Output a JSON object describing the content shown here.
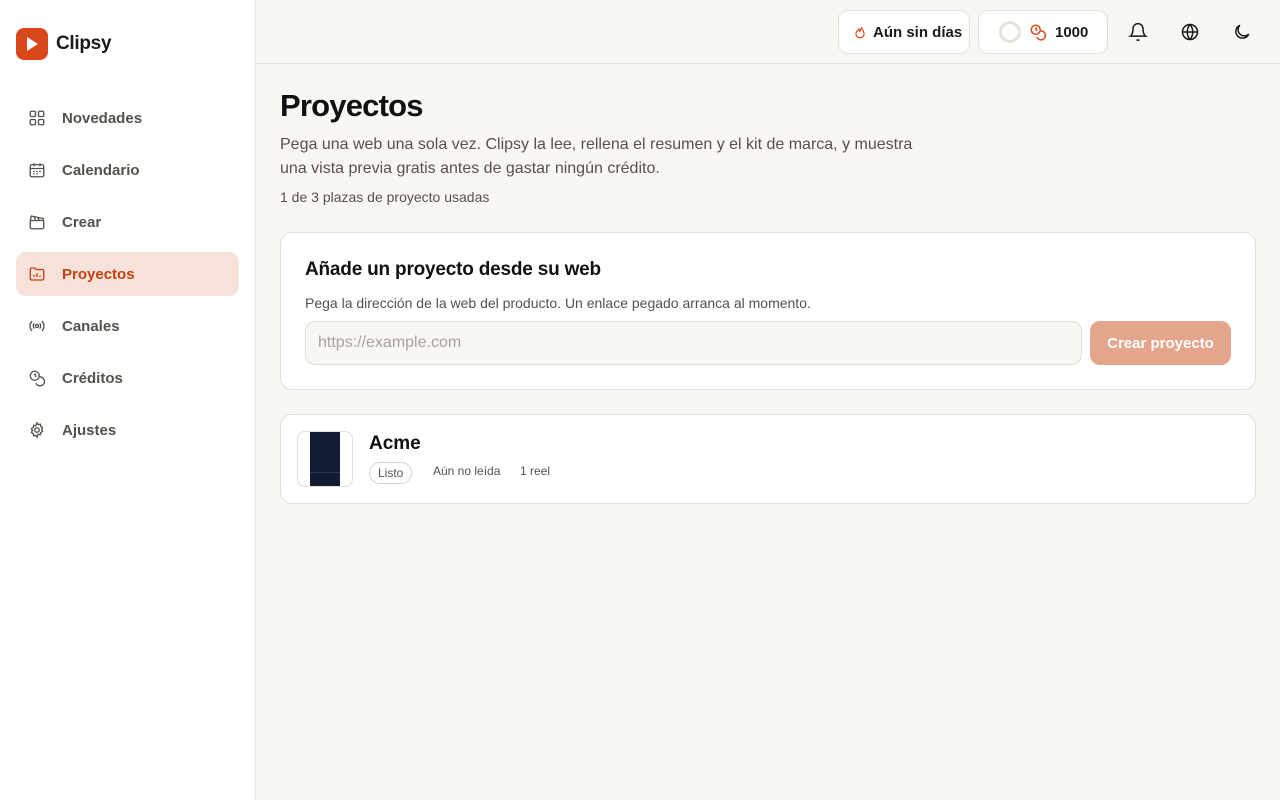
{
  "app": {
    "name": "Clipsy"
  },
  "sidebar": {
    "items": [
      {
        "label": "Novedades",
        "icon": "grid-icon",
        "active": false
      },
      {
        "label": "Calendario",
        "icon": "calendar-icon",
        "active": false
      },
      {
        "label": "Crear",
        "icon": "clapperboard-icon",
        "active": false
      },
      {
        "label": "Proyectos",
        "icon": "folder-chart-icon",
        "active": true
      },
      {
        "label": "Canales",
        "icon": "broadcast-icon",
        "active": false
      },
      {
        "label": "Créditos",
        "icon": "coins-icon",
        "active": false
      },
      {
        "label": "Ajustes",
        "icon": "gear-icon",
        "active": false
      }
    ]
  },
  "topbar": {
    "streak_label": "Aún sin días",
    "credits_value": "1000"
  },
  "page": {
    "title": "Proyectos",
    "description": "Pega una web una sola vez. Clipsy la lee, rellena el resumen y el kit de marca, y muestra una vista previa gratis antes de gastar ningún crédito.",
    "slots": "1 de 3 plazas de proyecto usadas"
  },
  "add_project": {
    "title": "Añade un proyecto desde su web",
    "description": "Pega la dirección de la web del producto. Un enlace pegado arranca al momento.",
    "placeholder": "https://example.com",
    "button_label": "Crear proyecto"
  },
  "projects": [
    {
      "name": "Acme",
      "status": "Listo",
      "read_state": "Aún no leída",
      "reels": "1 reel"
    }
  ],
  "colors": {
    "accent": "#d9481a",
    "active_bg": "#f6e2d9",
    "active_text": "#c2410c",
    "button_disabled": "#e3a58c"
  }
}
